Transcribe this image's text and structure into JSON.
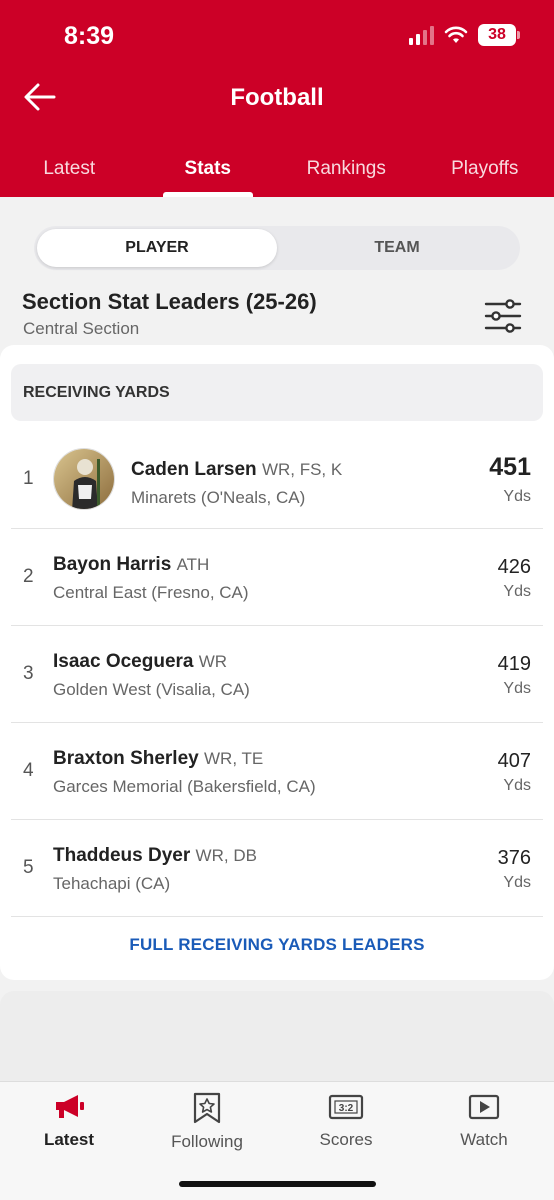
{
  "status": {
    "time": "8:39",
    "battery": "38"
  },
  "header": {
    "title": "Football",
    "back_icon": "arrow-left-icon"
  },
  "tabs": [
    {
      "label": "Latest",
      "active": false
    },
    {
      "label": "Stats",
      "active": true
    },
    {
      "label": "Rankings",
      "active": false
    },
    {
      "label": "Playoffs",
      "active": false
    }
  ],
  "segment": {
    "options": [
      "PLAYER",
      "TEAM"
    ],
    "selected": "PLAYER"
  },
  "section": {
    "title": "Section Stat Leaders (25-26)",
    "subtitle": "Central Section",
    "filter_icon": "sliders-icon"
  },
  "leaders": {
    "category": "RECEIVING YARDS",
    "rows": [
      {
        "rank": "1",
        "name": "Caden Larsen",
        "positions": "WR, FS, K",
        "school": "Minarets (O'Neals, CA)",
        "value": "451",
        "unit": "Yds"
      },
      {
        "rank": "2",
        "name": "Bayon Harris",
        "positions": "ATH",
        "school": "Central East (Fresno, CA)",
        "value": "426",
        "unit": "Yds"
      },
      {
        "rank": "3",
        "name": "Isaac Oceguera",
        "positions": "WR",
        "school": "Golden West (Visalia, CA)",
        "value": "419",
        "unit": "Yds"
      },
      {
        "rank": "4",
        "name": "Braxton Sherley",
        "positions": "WR, TE",
        "school": "Garces Memorial (Bakersfield, CA)",
        "value": "407",
        "unit": "Yds"
      },
      {
        "rank": "5",
        "name": "Thaddeus Dyer",
        "positions": "WR, DB",
        "school": "Tehachapi (CA)",
        "value": "376",
        "unit": "Yds"
      }
    ],
    "full_link": "FULL RECEIVING YARDS LEADERS"
  },
  "bottom_nav": [
    {
      "label": "Latest",
      "icon": "megaphone-icon",
      "active": true
    },
    {
      "label": "Following",
      "icon": "bookmark-star-icon",
      "active": false
    },
    {
      "label": "Scores",
      "icon": "scoreboard-icon",
      "active": false
    },
    {
      "label": "Watch",
      "icon": "play-icon",
      "active": false
    }
  ],
  "colors": {
    "brand": "#cc0027",
    "link": "#1a5bb8"
  }
}
